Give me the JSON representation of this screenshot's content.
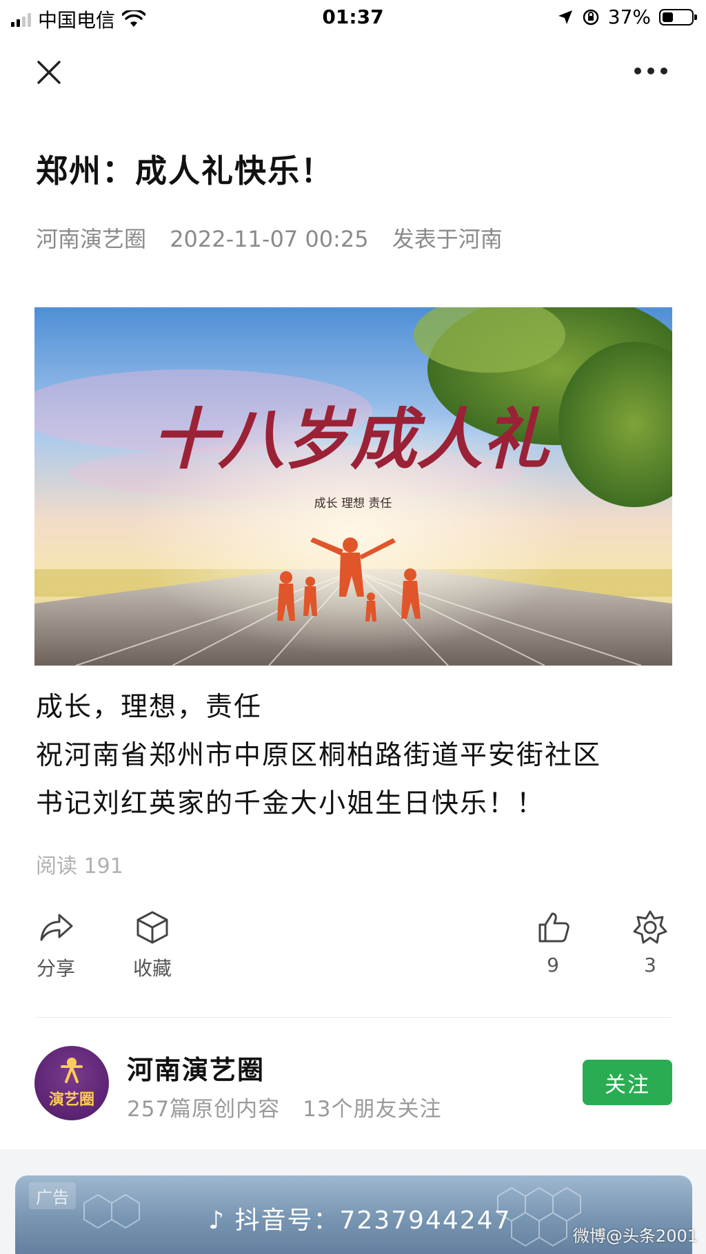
{
  "status_bar": {
    "carrier": "中国电信",
    "time": "01:37",
    "battery_percent_text": "37%",
    "battery_level": 0.37
  },
  "article": {
    "title": "郑州：成人礼快乐！",
    "author": "河南演艺圈",
    "date": "2022-11-07 00:25",
    "location": "发表于河南",
    "banner": {
      "headline": "十八岁成人礼",
      "tagline": "成长   理想   责任"
    },
    "body_lines": [
      "成长，理想，责任",
      "祝河南省郑州市中原区桐柏路街道平安街社区",
      "书记刘红英家的千金大小姐生日快乐！！"
    ],
    "reads": "阅读 191"
  },
  "actions": {
    "share_label": "分享",
    "favorite_label": "收藏",
    "like_count": "9",
    "wow_count": "3"
  },
  "account": {
    "avatar_text": "演艺圈",
    "name": "河南演艺圈",
    "original_posts": "257篇原创内容",
    "friends_following": "13个朋友关注",
    "follow_label": "关注"
  },
  "ad": {
    "label": "广告",
    "text": "抖音号：7237944247"
  },
  "watermark": "微博@头条2001",
  "colors": {
    "follow_green": "#2aad52",
    "meta_gray": "#8a8a8a",
    "avatar_purple": "#5e2377"
  }
}
